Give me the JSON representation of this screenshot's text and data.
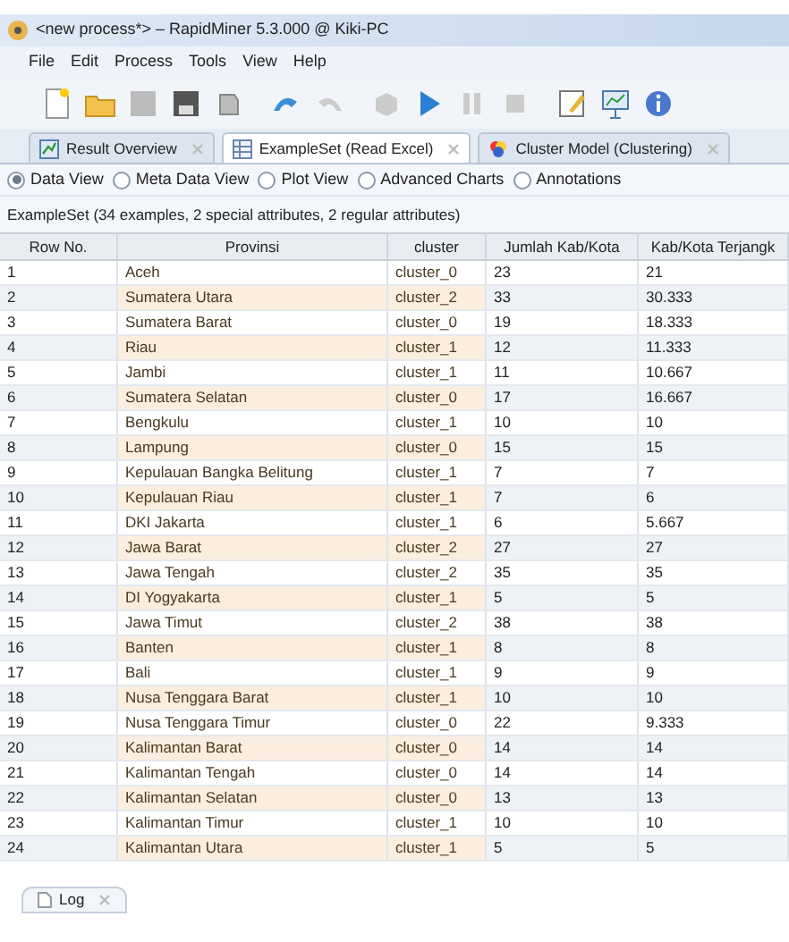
{
  "window": {
    "title": "<new process*> – RapidMiner 5.3.000 @ Kiki-PC"
  },
  "menu": [
    "File",
    "Edit",
    "Process",
    "Tools",
    "View",
    "Help"
  ],
  "tabs": [
    {
      "label": "Result Overview",
      "selected": false,
      "kind": "chart"
    },
    {
      "label": "ExampleSet (Read Excel)",
      "selected": true,
      "kind": "table"
    },
    {
      "label": "Cluster Model (Clustering)",
      "selected": false,
      "kind": "cluster"
    }
  ],
  "views": [
    {
      "label": "Data View",
      "selected": true
    },
    {
      "label": "Meta Data View",
      "selected": false
    },
    {
      "label": "Plot View",
      "selected": false
    },
    {
      "label": "Advanced Charts",
      "selected": false
    },
    {
      "label": "Annotations",
      "selected": false
    }
  ],
  "summary": "ExampleSet (34 examples, 2 special attributes, 2 regular attributes)",
  "table": {
    "columns": [
      "Row No.",
      "Provinsi",
      "cluster",
      "Jumlah Kab/Kota",
      "Kab/Kota Terjangk"
    ],
    "rows": [
      [
        "1",
        "Aceh",
        "cluster_0",
        "23",
        "21"
      ],
      [
        "2",
        "Sumatera Utara",
        "cluster_2",
        "33",
        "30.333"
      ],
      [
        "3",
        "Sumatera Barat",
        "cluster_0",
        "19",
        "18.333"
      ],
      [
        "4",
        "Riau",
        "cluster_1",
        "12",
        "11.333"
      ],
      [
        "5",
        "Jambi",
        "cluster_1",
        "11",
        "10.667"
      ],
      [
        "6",
        "Sumatera Selatan",
        "cluster_0",
        "17",
        "16.667"
      ],
      [
        "7",
        "Bengkulu",
        "cluster_1",
        "10",
        "10"
      ],
      [
        "8",
        "Lampung",
        "cluster_0",
        "15",
        "15"
      ],
      [
        "9",
        "Kepulauan Bangka Belitung",
        "cluster_1",
        "7",
        "7"
      ],
      [
        "10",
        "Kepulauan Riau",
        "cluster_1",
        "7",
        "6"
      ],
      [
        "11",
        "DKI Jakarta",
        "cluster_1",
        "6",
        "5.667"
      ],
      [
        "12",
        "Jawa Barat",
        "cluster_2",
        "27",
        "27"
      ],
      [
        "13",
        "Jawa Tengah",
        "cluster_2",
        "35",
        "35"
      ],
      [
        "14",
        "DI Yogyakarta",
        "cluster_1",
        "5",
        "5"
      ],
      [
        "15",
        "Jawa Timut",
        "cluster_2",
        "38",
        "38"
      ],
      [
        "16",
        "Banten",
        "cluster_1",
        "8",
        "8"
      ],
      [
        "17",
        "Bali",
        "cluster_1",
        "9",
        "9"
      ],
      [
        "18",
        "Nusa Tenggara Barat",
        "cluster_1",
        "10",
        "10"
      ],
      [
        "19",
        "Nusa Tenggara Timur",
        "cluster_0",
        "22",
        "9.333"
      ],
      [
        "20",
        "Kalimantan Barat",
        "cluster_0",
        "14",
        "14"
      ],
      [
        "21",
        "Kalimantan Tengah",
        "cluster_0",
        "14",
        "14"
      ],
      [
        "22",
        "Kalimantan Selatan",
        "cluster_0",
        "13",
        "13"
      ],
      [
        "23",
        "Kalimantan Timur",
        "cluster_1",
        "10",
        "10"
      ],
      [
        "24",
        "Kalimantan Utara",
        "cluster_1",
        "5",
        "5"
      ]
    ]
  },
  "bottom_tab": {
    "label": "Log"
  }
}
